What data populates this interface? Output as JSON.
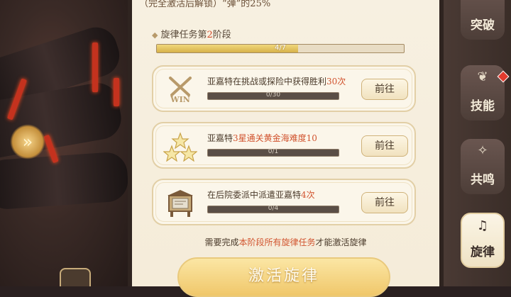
{
  "header": {
    "cut_off_text": "（完全激活后解锁）“弹”的25%"
  },
  "stage": {
    "title_prefix": "旋律任务第",
    "stage_number": "2",
    "title_suffix": "阶段",
    "progress_label": "4/7",
    "progress_fraction": 0.571
  },
  "tasks": [
    {
      "icon": "win-swords-icon",
      "desc_prefix": "亚嘉特在挑战或探险中获得胜利",
      "desc_highlight": "30次",
      "desc_suffix": "",
      "progress_label": "0/30",
      "progress_fraction": 0,
      "go_label": "前往"
    },
    {
      "icon": "three-stars-icon",
      "desc_prefix": "亚嘉特",
      "desc_highlight": "3星通关黄金海难度10",
      "desc_suffix": "",
      "progress_label": "0/1",
      "progress_fraction": 0,
      "go_label": "前往"
    },
    {
      "icon": "house-board-icon",
      "desc_prefix": "在后院委派中派遣亚嘉特",
      "desc_highlight": "4次",
      "desc_suffix": "",
      "progress_label": "0/4",
      "progress_fraction": 0,
      "go_label": "前往"
    }
  ],
  "notice": {
    "prefix": "需要完成",
    "highlight": "本阶段所有旋律任务",
    "suffix": "才能激活旋律"
  },
  "activate_button": "激活旋律",
  "win_text": "WIN",
  "nav": [
    {
      "label": "突破",
      "icon": "breakthrough-icon",
      "active": false,
      "badge": false
    },
    {
      "label": "技能",
      "icon": "skill-icon",
      "active": false,
      "badge": true
    },
    {
      "label": "共鸣",
      "icon": "resonance-icon",
      "active": false,
      "badge": false
    },
    {
      "label": "旋律",
      "icon": "melody-icon",
      "active": true,
      "badge": false
    }
  ],
  "colors": {
    "highlight": "#d1542f",
    "panel_bg": "#f7f0e1",
    "accent_gold": "#f0c76a"
  }
}
